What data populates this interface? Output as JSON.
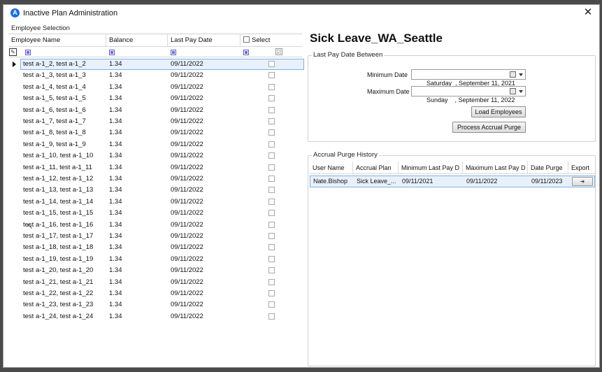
{
  "window": {
    "title": "Inactive Plan Administration"
  },
  "employee_selection": {
    "caption": "Employee Selection",
    "columns": {
      "name": "Employee Name",
      "balance": "Balance",
      "last_pay_date": "Last Pay Date",
      "select": "Select"
    },
    "rows": [
      {
        "name": "test a-1_2, test a-1_2",
        "balance": "1.34",
        "date": "09/11/2022"
      },
      {
        "name": "test a-1_3, test a-1_3",
        "balance": "1.34",
        "date": "09/11/2022"
      },
      {
        "name": "test a-1_4, test a-1_4",
        "balance": "1.34",
        "date": "09/11/2022"
      },
      {
        "name": "test a-1_5, test a-1_5",
        "balance": "1.34",
        "date": "09/11/2022"
      },
      {
        "name": "test a-1_6, test a-1_6",
        "balance": "1.34",
        "date": "09/11/2022"
      },
      {
        "name": "test a-1_7, test a-1_7",
        "balance": "1.34",
        "date": "09/11/2022"
      },
      {
        "name": "test a-1_8, test a-1_8",
        "balance": "1.34",
        "date": "09/11/2022"
      },
      {
        "name": "test a-1_9, test a-1_9",
        "balance": "1.34",
        "date": "09/11/2022"
      },
      {
        "name": "test a-1_10, test a-1_10",
        "balance": "1.34",
        "date": "09/11/2022"
      },
      {
        "name": "test a-1_11, test a-1_11",
        "balance": "1.34",
        "date": "09/11/2022"
      },
      {
        "name": "test a-1_12, test a-1_12",
        "balance": "1.34",
        "date": "09/11/2022"
      },
      {
        "name": "test a-1_13, test a-1_13",
        "balance": "1.34",
        "date": "09/11/2022"
      },
      {
        "name": "test a-1_14, test a-1_14",
        "balance": "1.34",
        "date": "09/11/2022"
      },
      {
        "name": "test a-1_15, test a-1_15",
        "balance": "1.34",
        "date": "09/11/2022"
      },
      {
        "name": "test a-1_16, test a-1_16",
        "balance": "1.34",
        "date": "09/11/2022"
      },
      {
        "name": "test a-1_17, test a-1_17",
        "balance": "1.34",
        "date": "09/11/2022"
      },
      {
        "name": "test a-1_18, test a-1_18",
        "balance": "1.34",
        "date": "09/11/2022"
      },
      {
        "name": "test a-1_19, test a-1_19",
        "balance": "1.34",
        "date": "09/11/2022"
      },
      {
        "name": "test a-1_20, test a-1_20",
        "balance": "1.34",
        "date": "09/11/2022"
      },
      {
        "name": "test a-1_21, test a-1_21",
        "balance": "1.34",
        "date": "09/11/2022"
      },
      {
        "name": "test a-1_22, test a-1_22",
        "balance": "1.34",
        "date": "09/11/2022"
      },
      {
        "name": "test a-1_23, test a-1_23",
        "balance": "1.34",
        "date": "09/11/2022"
      },
      {
        "name": "test a-1_24, test a-1_24",
        "balance": "1.34",
        "date": "09/11/2022"
      }
    ]
  },
  "plan": {
    "title": "Sick Leave_WA_Seattle"
  },
  "last_pay_date": {
    "caption": "Last Pay Date Between",
    "min_label": "Minimum Date",
    "min_value": "Saturday  , September 11, 2021",
    "max_label": "Maximum Date",
    "max_value": "Sunday    , September 11, 2022",
    "load_button": "Load Employees",
    "process_button": "Process Accrual Purge"
  },
  "history": {
    "caption": "Accrual Purge History",
    "columns": {
      "user": "User Name",
      "plan": "Accrual Plan",
      "min": "Minimum Last Pay D",
      "max": "Maximum Last Pay D",
      "purge": "Date Purge",
      "export": "Export"
    },
    "row": {
      "user": "Nate.Bishop",
      "plan": "Sick Leave_...",
      "min": "09/11/2021",
      "max": "09/11/2022",
      "purge": "09/11/2023"
    }
  }
}
